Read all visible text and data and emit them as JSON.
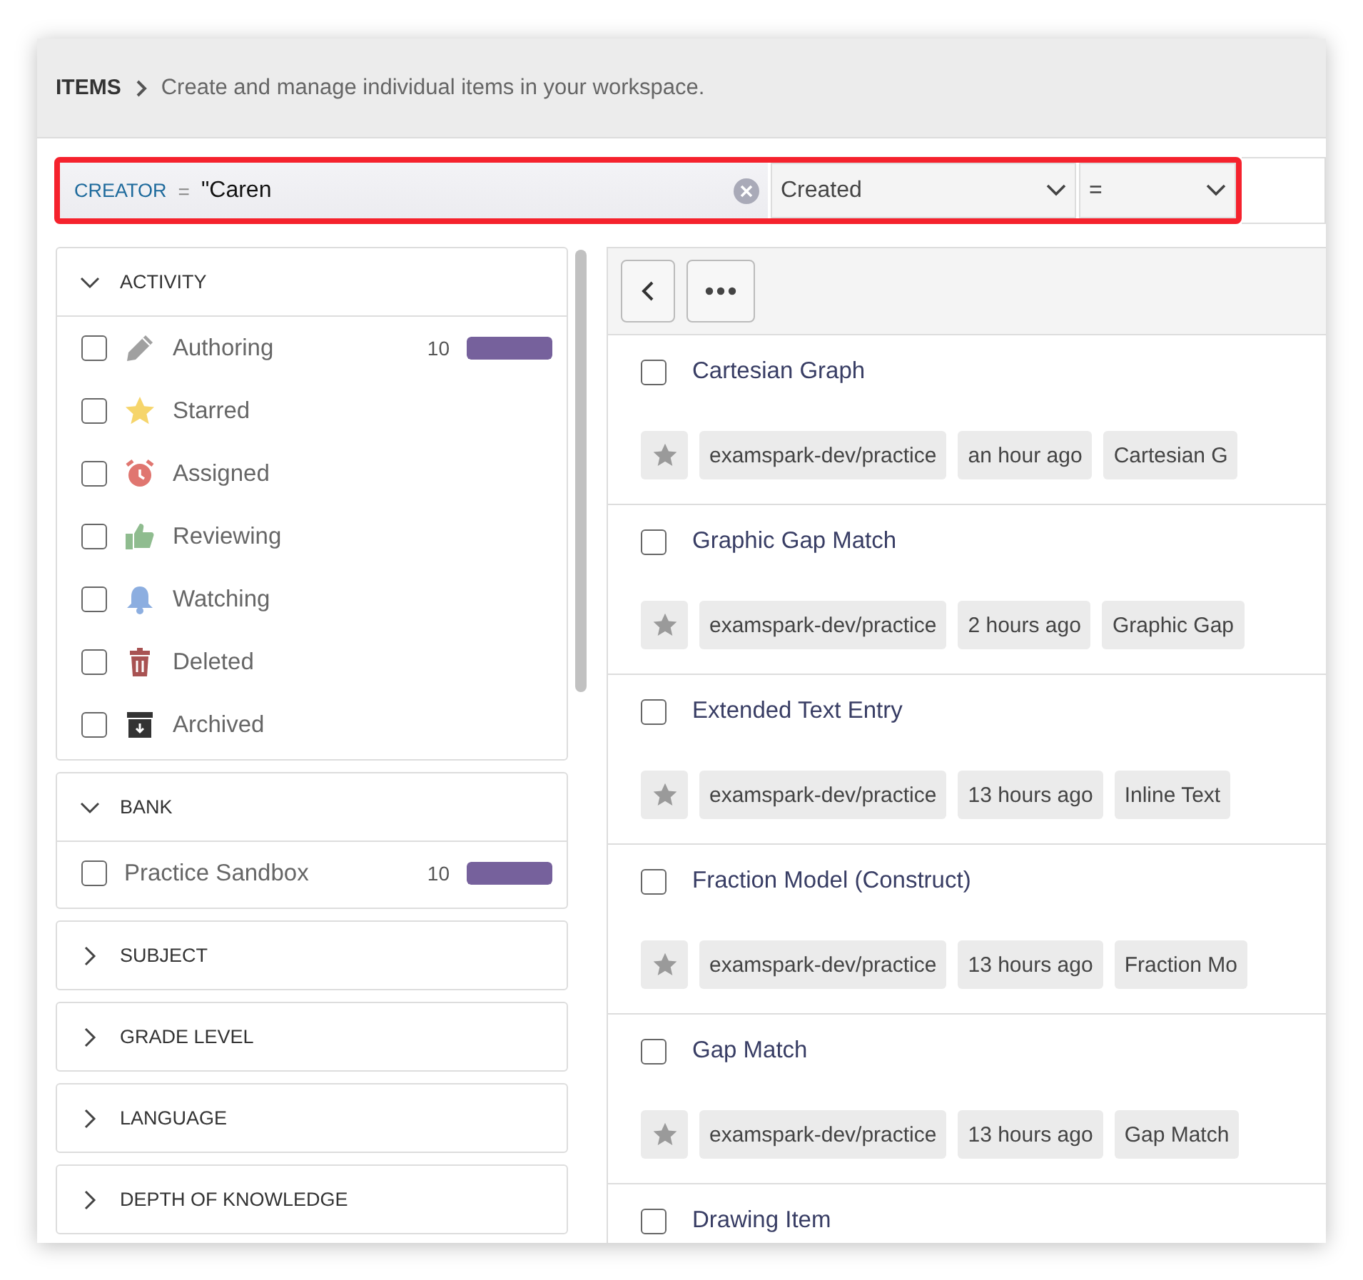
{
  "header": {
    "title": "ITEMS",
    "description": "Create and manage individual items in your workspace."
  },
  "filter": {
    "field": "CREATOR",
    "operator": "=",
    "value": "\"Caren",
    "select_1": "Created",
    "select_2": "="
  },
  "sidebar": [
    {
      "title": "ACTIVITY",
      "expanded": true,
      "items": [
        {
          "label": "Authoring",
          "checked": false,
          "count": "10",
          "level": 1
        },
        {
          "label": "Starred",
          "checked": false
        },
        {
          "label": "Assigned",
          "checked": false
        },
        {
          "label": "Reviewing",
          "checked": false
        },
        {
          "label": "Watching",
          "checked": false
        },
        {
          "label": "Deleted",
          "checked": false
        },
        {
          "label": "Archived",
          "checked": false
        }
      ]
    },
    {
      "title": "BANK",
      "expanded": true,
      "items": [
        {
          "label": "Practice Sandbox",
          "checked": false,
          "count": "10",
          "level": 1
        }
      ]
    },
    {
      "title": "SUBJECT",
      "expanded": false
    },
    {
      "title": "GRADE LEVEL",
      "expanded": false
    },
    {
      "title": "LANGUAGE",
      "expanded": false
    },
    {
      "title": "DEPTH OF KNOWLEDGE",
      "expanded": false
    }
  ],
  "items": [
    {
      "title": "Cartesian Graph",
      "checked": false,
      "tags": [
        "examspark-dev/practice",
        "an hour ago",
        "Cartesian G"
      ]
    },
    {
      "title": "Graphic Gap Match",
      "checked": false,
      "tags": [
        "examspark-dev/practice",
        "2 hours ago",
        "Graphic Gap"
      ]
    },
    {
      "title": "Extended Text Entry",
      "checked": false,
      "tags": [
        "examspark-dev/practice",
        "13 hours ago",
        "Inline Text"
      ]
    },
    {
      "title": "Fraction Model (Construct)",
      "checked": false,
      "tags": [
        "examspark-dev/practice",
        "13 hours ago",
        "Fraction Mo"
      ]
    },
    {
      "title": "Gap Match",
      "checked": false,
      "tags": [
        "examspark-dev/practice",
        "13 hours ago",
        "Gap Match"
      ]
    },
    {
      "title": "Drawing Item",
      "checked": false
    }
  ]
}
